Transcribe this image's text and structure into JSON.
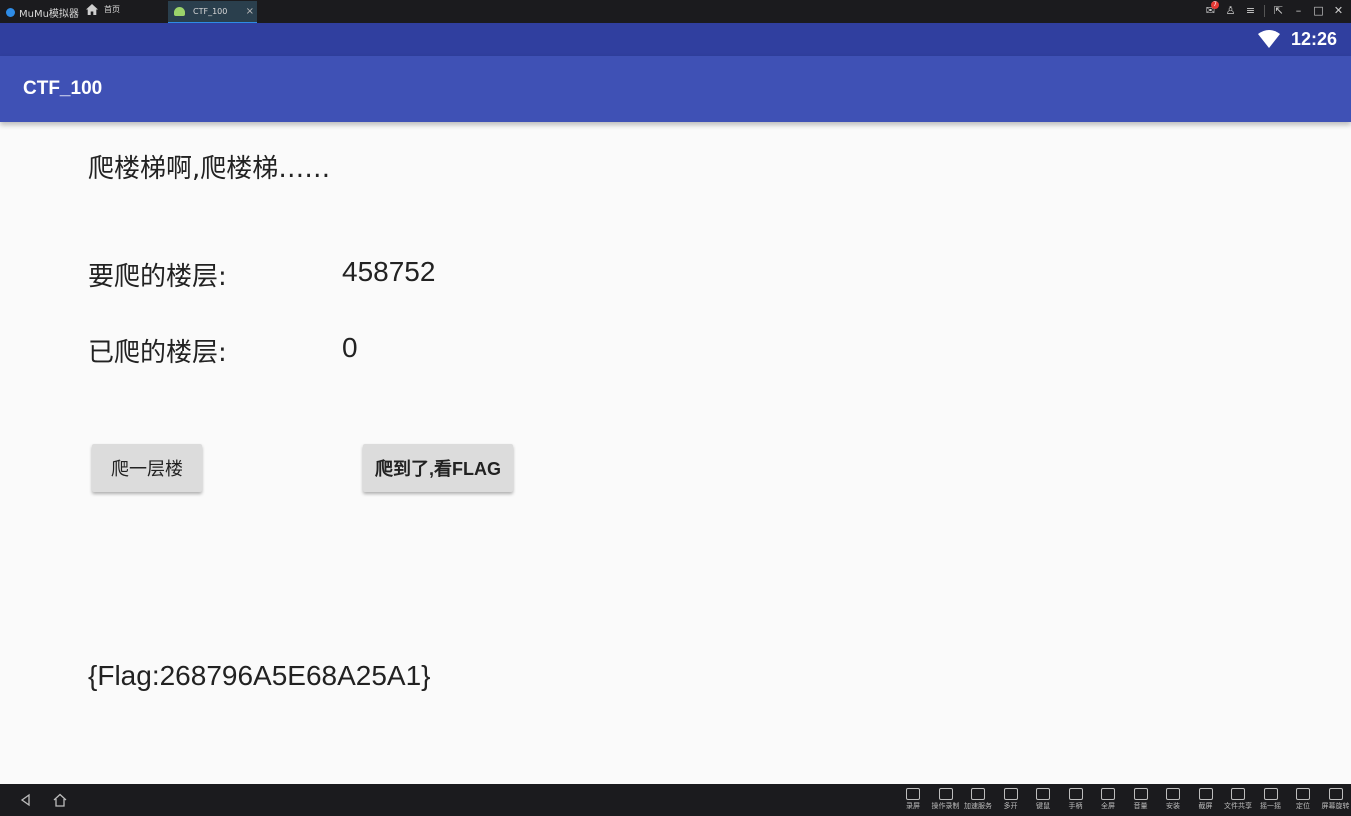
{
  "emulator": {
    "app_name": "MuMu模拟器",
    "home_tab_label": "首页",
    "active_tab_label": "CTF_100",
    "close_tab_glyph": "×",
    "notification_count": "7",
    "toolbar": [
      {
        "label": "录屏",
        "icon": "record-icon"
      },
      {
        "label": "操作录制",
        "icon": "macro-icon"
      },
      {
        "label": "加速服务",
        "icon": "rocket-icon"
      },
      {
        "label": "多开",
        "icon": "multi-instance-icon"
      },
      {
        "label": "键鼠",
        "icon": "keyboard-icon"
      },
      {
        "label": "手柄",
        "icon": "gamepad-icon"
      },
      {
        "label": "全屏",
        "icon": "fullscreen-icon"
      },
      {
        "label": "音量",
        "icon": "volume-icon"
      },
      {
        "label": "安装",
        "icon": "apk-icon"
      },
      {
        "label": "截屏",
        "icon": "crop-icon"
      },
      {
        "label": "文件共享",
        "icon": "folder-icon"
      },
      {
        "label": "摇一摇",
        "icon": "shake-icon"
      },
      {
        "label": "定位",
        "icon": "location-icon"
      },
      {
        "label": "屏幕旋转",
        "icon": "rotate-icon"
      }
    ]
  },
  "status_bar": {
    "time": "12:26"
  },
  "app_bar": {
    "title": "CTF_100"
  },
  "content": {
    "heading": "爬楼梯啊,爬楼梯……",
    "floors_to_climb_label": "要爬的楼层:",
    "floors_to_climb_value": "458752",
    "floors_climbed_label": "已爬的楼层:",
    "floors_climbed_value": "0",
    "climb_button": "爬一层楼",
    "flag_button": "爬到了,看FLAG",
    "flag_text": "{Flag:268796A5E68A25A1}"
  },
  "colors": {
    "status_bar": "#303f9f",
    "app_bar": "#3f51b5",
    "background": "#fafafa",
    "emulator_chrome": "#1b1b1e"
  }
}
